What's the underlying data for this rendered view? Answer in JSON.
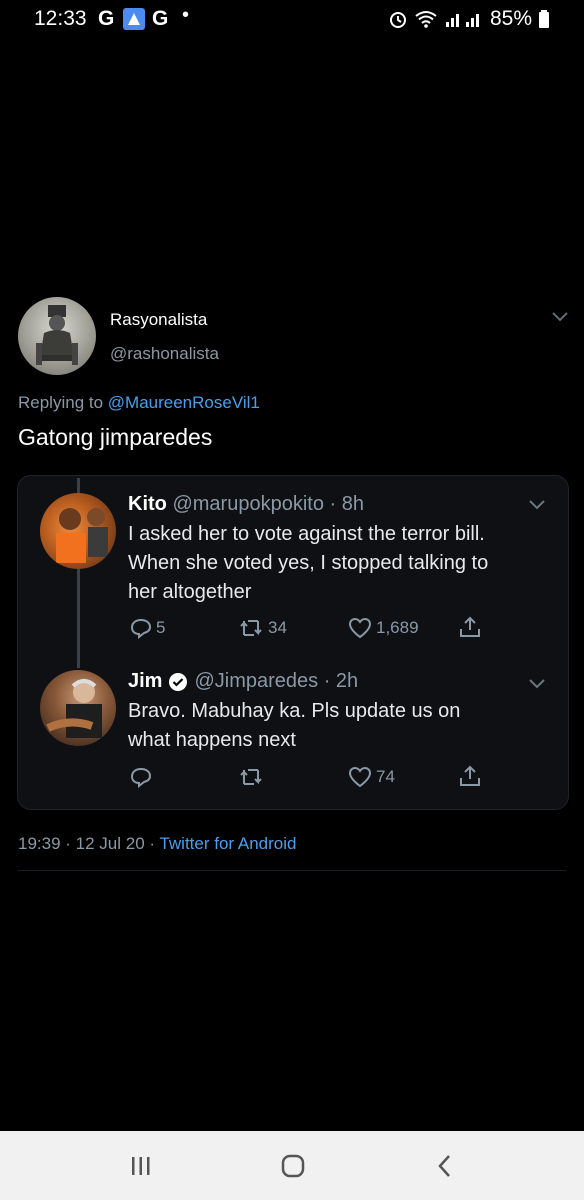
{
  "status_bar": {
    "time": "12:33",
    "g1": "G",
    "g2": "G",
    "dot": "•",
    "battery": "85%"
  },
  "tweet": {
    "author_name": "Rasyonalista",
    "author_handle": "@rashonalista",
    "replying_prefix": "Replying to ",
    "replying_to": "@MaureenRoseVil1",
    "text": "Gatong jimparedes",
    "date": "19:39 · 12 Jul 20 · ",
    "source": "Twitter for Android"
  },
  "quoted": [
    {
      "name": "Kito",
      "handle": "@marupokpokito · 8h",
      "text_lines": [
        "I asked her to vote against the terror bill.",
        "When she voted yes, I stopped talking to",
        "her altogether"
      ],
      "replies": "5",
      "retweets": "34",
      "likes": "1,689"
    },
    {
      "name": "Jim",
      "handle": "@Jimparedes · 2h",
      "text_lines": [
        "Bravo. Mabuhay ka. Pls update us on",
        "what happens next"
      ],
      "replies": "",
      "retweets": "",
      "likes": "74"
    }
  ]
}
